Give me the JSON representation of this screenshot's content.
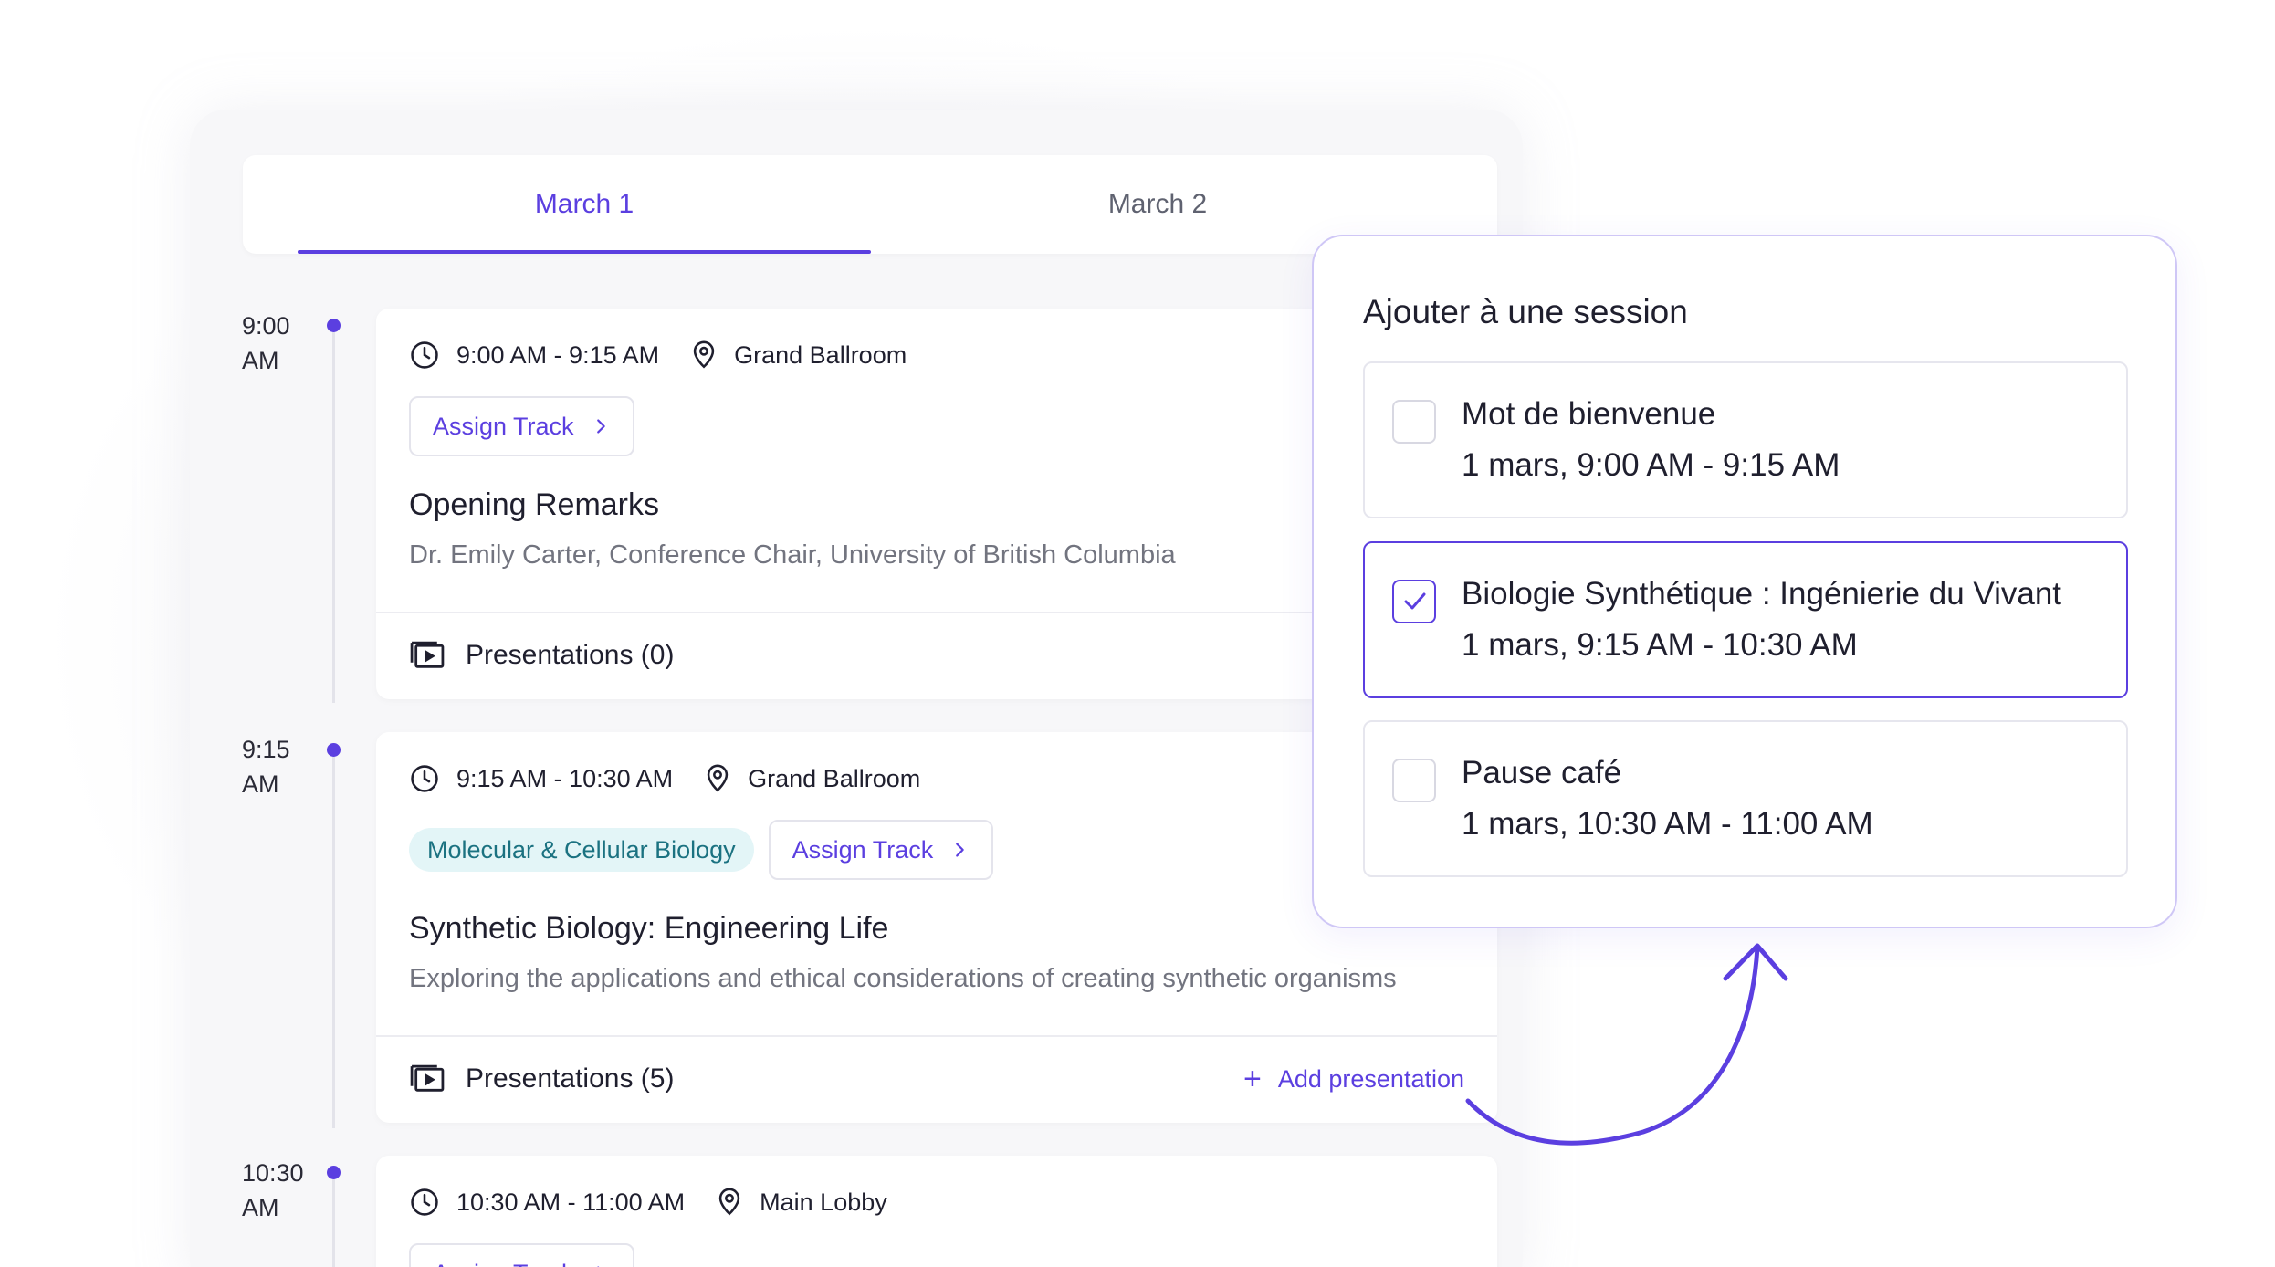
{
  "tabs": [
    {
      "label": "March 1",
      "active": true
    },
    {
      "label": "March 2",
      "active": false
    }
  ],
  "sessions": [
    {
      "time_start_line1": "9:00",
      "time_start_line2": "AM",
      "range": "9:00 AM - 9:15 AM",
      "location": "Grand Ballroom",
      "track": "",
      "assign_label": "Assign Track",
      "title": "Opening Remarks",
      "description": "Dr. Emily Carter, Conference Chair, University of British Columbia",
      "presentations": "Presentations (0)"
    },
    {
      "time_start_line1": "9:15",
      "time_start_line2": "AM",
      "range": "9:15 AM - 10:30 AM",
      "location": "Grand Ballroom",
      "track": "Molecular & Cellular Biology",
      "assign_label": "Assign Track",
      "title": "Synthetic Biology: Engineering Life",
      "description": "Exploring the applications and ethical considerations of creating synthetic organisms",
      "presentations": "Presentations (5)",
      "add_presentation": "Add presentation"
    },
    {
      "time_start_line1": "10:30",
      "time_start_line2": "AM",
      "range": "10:30 AM - 11:00 AM",
      "location": "Main Lobby",
      "assign_label": "Assign Track"
    }
  ],
  "popup": {
    "title": "Ajouter à une session",
    "options": [
      {
        "name": "Mot de bienvenue",
        "time": "1 mars, 9:00 AM - 9:15 AM",
        "checked": false
      },
      {
        "name": "Biologie Synthétique : Ingénierie du Vivant",
        "time": "1 mars, 9:15 AM - 10:30 AM",
        "checked": true
      },
      {
        "name": "Pause café",
        "time": "1 mars, 10:30 AM - 11:00 AM",
        "checked": false
      }
    ]
  },
  "colors": {
    "accent": "#5b3fe0",
    "track_chip_bg": "#e3f5f7",
    "track_chip_text": "#1b7281",
    "muted_text": "#72747f"
  },
  "icons": {
    "clock": "clock-icon",
    "location": "location-pin-icon",
    "chevron": "chevron-right-icon",
    "presentations": "presentation-play-icon",
    "plus": "plus-icon",
    "check": "check-icon"
  }
}
